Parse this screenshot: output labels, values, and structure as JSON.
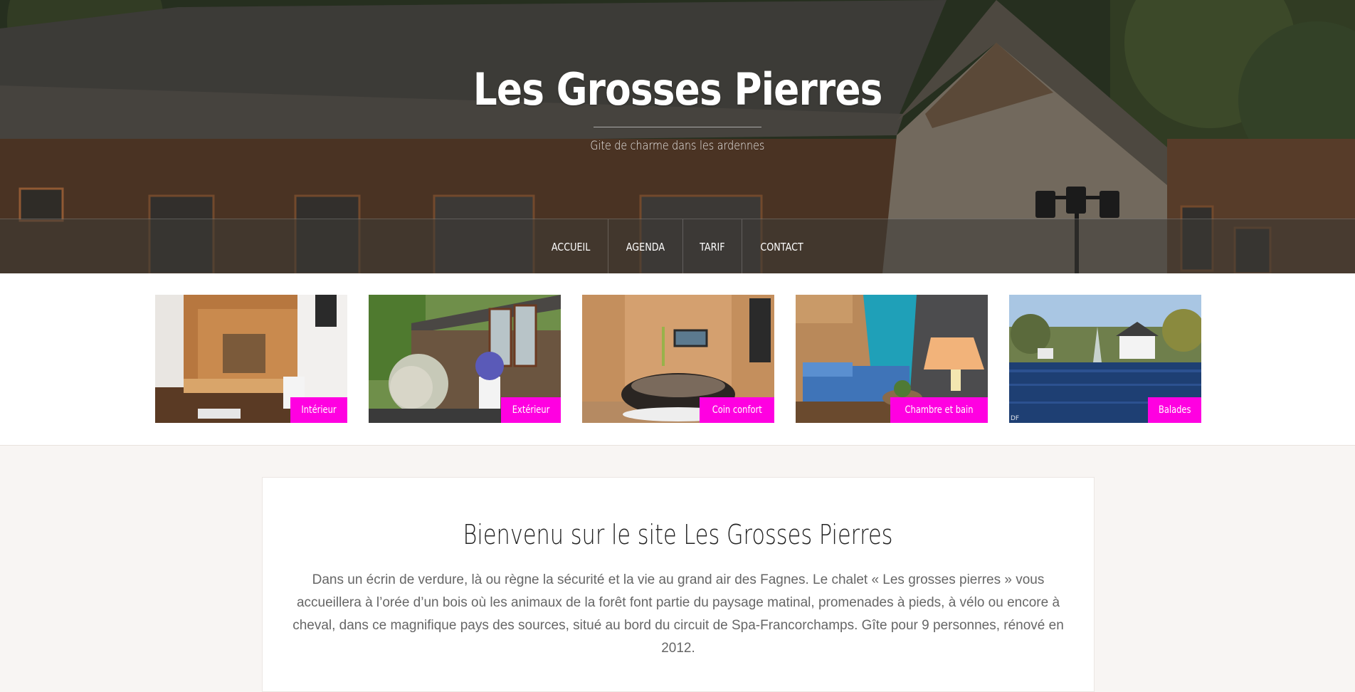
{
  "header": {
    "site_title": "Les Grosses Pierres",
    "tagline": "Gite de charme dans les ardennes"
  },
  "nav": {
    "items": [
      {
        "label": "ACCUEIL"
      },
      {
        "label": "AGENDA"
      },
      {
        "label": "TARIF"
      },
      {
        "label": "CONTACT"
      }
    ]
  },
  "gallery": {
    "items": [
      {
        "label": "Intérieur",
        "image": "wooden chalet interior with kitchen counter"
      },
      {
        "label": "Extérieur",
        "image": "chalet wooden facade with flowers"
      },
      {
        "label": "Coin confort",
        "image": "jacuzzi in wooden room"
      },
      {
        "label": "Chambre et bain",
        "image": "bedroom with turquoise canopy and lamp"
      },
      {
        "label": "Balades",
        "image": "lake with fountain and white house"
      }
    ],
    "watermark": "DF",
    "label_color": "#ff00e1"
  },
  "main": {
    "heading": "Bienvenu sur le site Les Grosses Pierres",
    "body": "Dans un écrin de verdure, là ou règne la sécurité et la vie au grand air des Fagnes. Le chalet « Les grosses pierres » vous accueillera à l’orée d’un bois où les animaux de la forêt font partie du paysage matinal, promenades à pieds, à vélo ou encore à cheval, dans ce magnifique pays des sources, situé au bord du circuit de Spa-Francorchamps. Gîte pour 9 personnes, rénové en 2012."
  }
}
